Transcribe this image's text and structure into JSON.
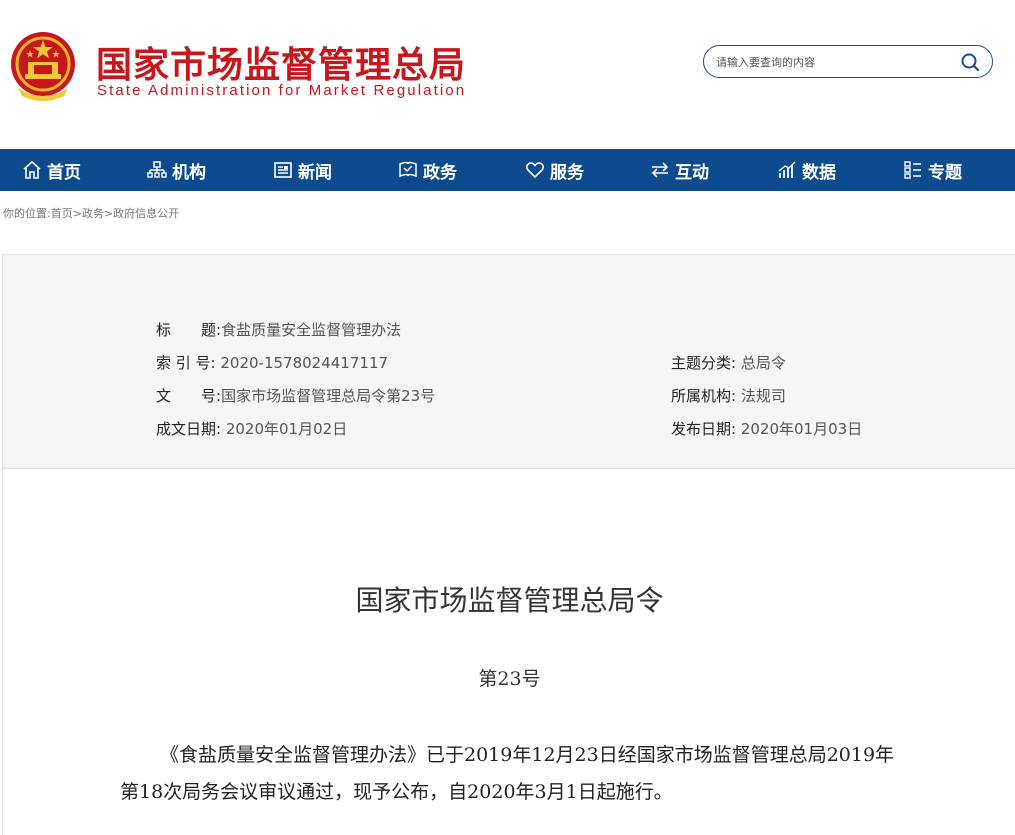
{
  "header": {
    "title_cn": "国家市场监督管理总局",
    "title_en": "State Administration for Market Regulation",
    "brand_color": "#c8161d",
    "emblem_icon": "national-emblem-icon"
  },
  "search": {
    "placeholder": "请输入要查询的内容",
    "icon": "search-icon"
  },
  "nav": {
    "bg_color": "#0e4a8e",
    "items": [
      {
        "label": "首页",
        "icon": "home-icon"
      },
      {
        "label": "机构",
        "icon": "org-chart-icon"
      },
      {
        "label": "新闻",
        "icon": "newspaper-icon"
      },
      {
        "label": "政务",
        "icon": "shield-book-icon"
      },
      {
        "label": "服务",
        "icon": "heart-icon"
      },
      {
        "label": "互动",
        "icon": "swap-arrows-icon"
      },
      {
        "label": "数据",
        "icon": "bar-chart-icon"
      },
      {
        "label": "专题",
        "icon": "grid-list-icon"
      }
    ]
  },
  "breadcrumb": "你的位置:首页>政务>政府信息公开",
  "meta": {
    "title_label": "标　　题:",
    "title_value": "食盐质量安全监督管理办法",
    "index_label": "索 引 号:",
    "index_value": "2020-1578024417117",
    "docno_label": "文　　号:",
    "docno_value": "国家市场监督管理总局令第23号",
    "created_label": "成文日期:",
    "created_value": "2020年01月02日",
    "category_label": "主题分类:",
    "category_value": "总局令",
    "org_label": "所属机构:",
    "org_value": "法规司",
    "published_label": "发布日期:",
    "published_value": "2020年01月03日"
  },
  "document": {
    "title": "国家市场监督管理总局令",
    "number": "第23号",
    "body": "《食盐质量安全监督管理办法》已于2019年12月23日经国家市场监督管理总局2019年第18次局务会议审议通过，现予公布，自2020年3月1日起施行。"
  }
}
